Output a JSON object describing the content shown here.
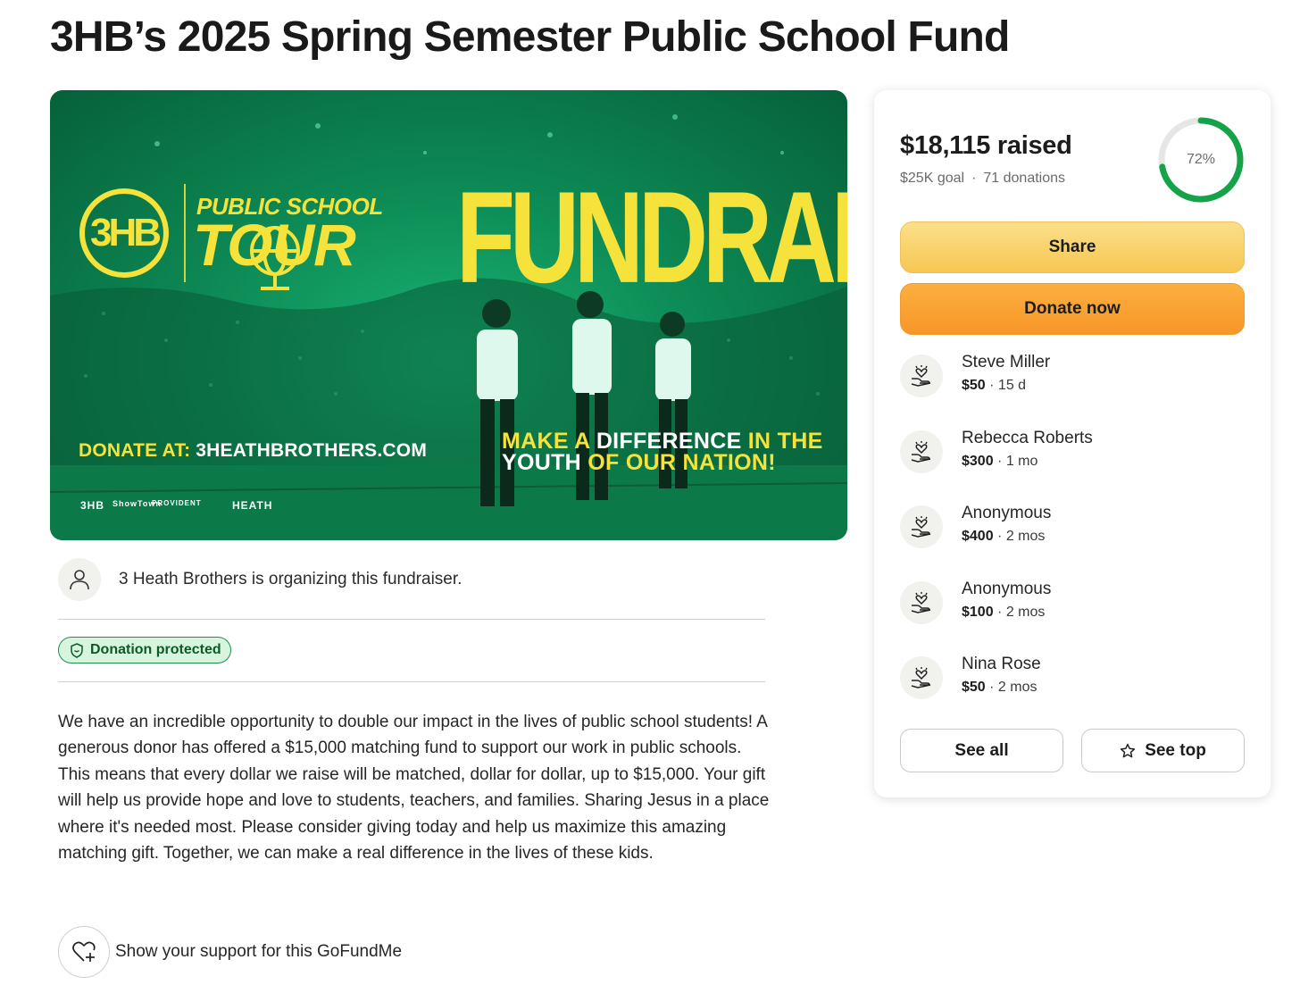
{
  "page": {
    "title": "3HB’s 2025 Spring Semester Public School Fund"
  },
  "hero": {
    "logo_text": "3HB",
    "tour_small": "PUBLIC SCHOOL",
    "tour_big": "TOUR",
    "fundraiser": "FUNDRAISER",
    "donate_prefix": "DONATE AT: ",
    "donate_url": "3HEATHBROTHERS.COM",
    "tagline_1a": "MAKE A ",
    "tagline_1b": "DIFFERENCE ",
    "tagline_1c": "IN THE",
    "tagline_2a": "YOUTH ",
    "tagline_2b": "OF OUR NATION!",
    "sponsors": [
      "3HB",
      "ShowTown",
      "PROVIDENT",
      "HEATH"
    ]
  },
  "organizer": {
    "text": "3 Heath Brothers is organizing this fundraiser."
  },
  "badge": {
    "label": "Donation protected"
  },
  "description": "We have an incredible opportunity to double our impact in the lives of public school students! A generous donor has offered a $15,000 matching fund to support our work in public schools. This means that every dollar we raise will be matched, dollar for dollar, up to $15,000. Your gift will help us provide hope and love to students, teachers, and families. Sharing Jesus in a place where it's needed most. Please consider giving today and help us maximize this amazing matching gift. Together, we can make a real difference in the lives of these kids.",
  "support": {
    "label": "Show your support for this GoFundMe"
  },
  "card": {
    "raised": "$18,115 raised",
    "goal": "$25K goal",
    "separator": "·",
    "donations": "71 donations",
    "progress_label": "72%",
    "progress_value": 0.72,
    "share_label": "Share",
    "donate_label": "Donate now",
    "donors": [
      {
        "name": "Steve Miller",
        "amount": "$50",
        "time": " · 15 d"
      },
      {
        "name": "Rebecca Roberts",
        "amount": "$300",
        "time": " · 1 mo"
      },
      {
        "name": "Anonymous",
        "amount": "$400",
        "time": " · 2 mos"
      },
      {
        "name": "Anonymous",
        "amount": "$100",
        "time": " · 2 mos"
      },
      {
        "name": "Nina Rose",
        "amount": "$50",
        "time": " · 2 mos"
      }
    ],
    "see_all_label": "See all",
    "see_top_label": "See top"
  },
  "colors": {
    "progress_green": "#15a34a",
    "share_yellow": "#f6c653",
    "donate_orange": "#f79628",
    "badge_green": "#1f8f4f"
  }
}
